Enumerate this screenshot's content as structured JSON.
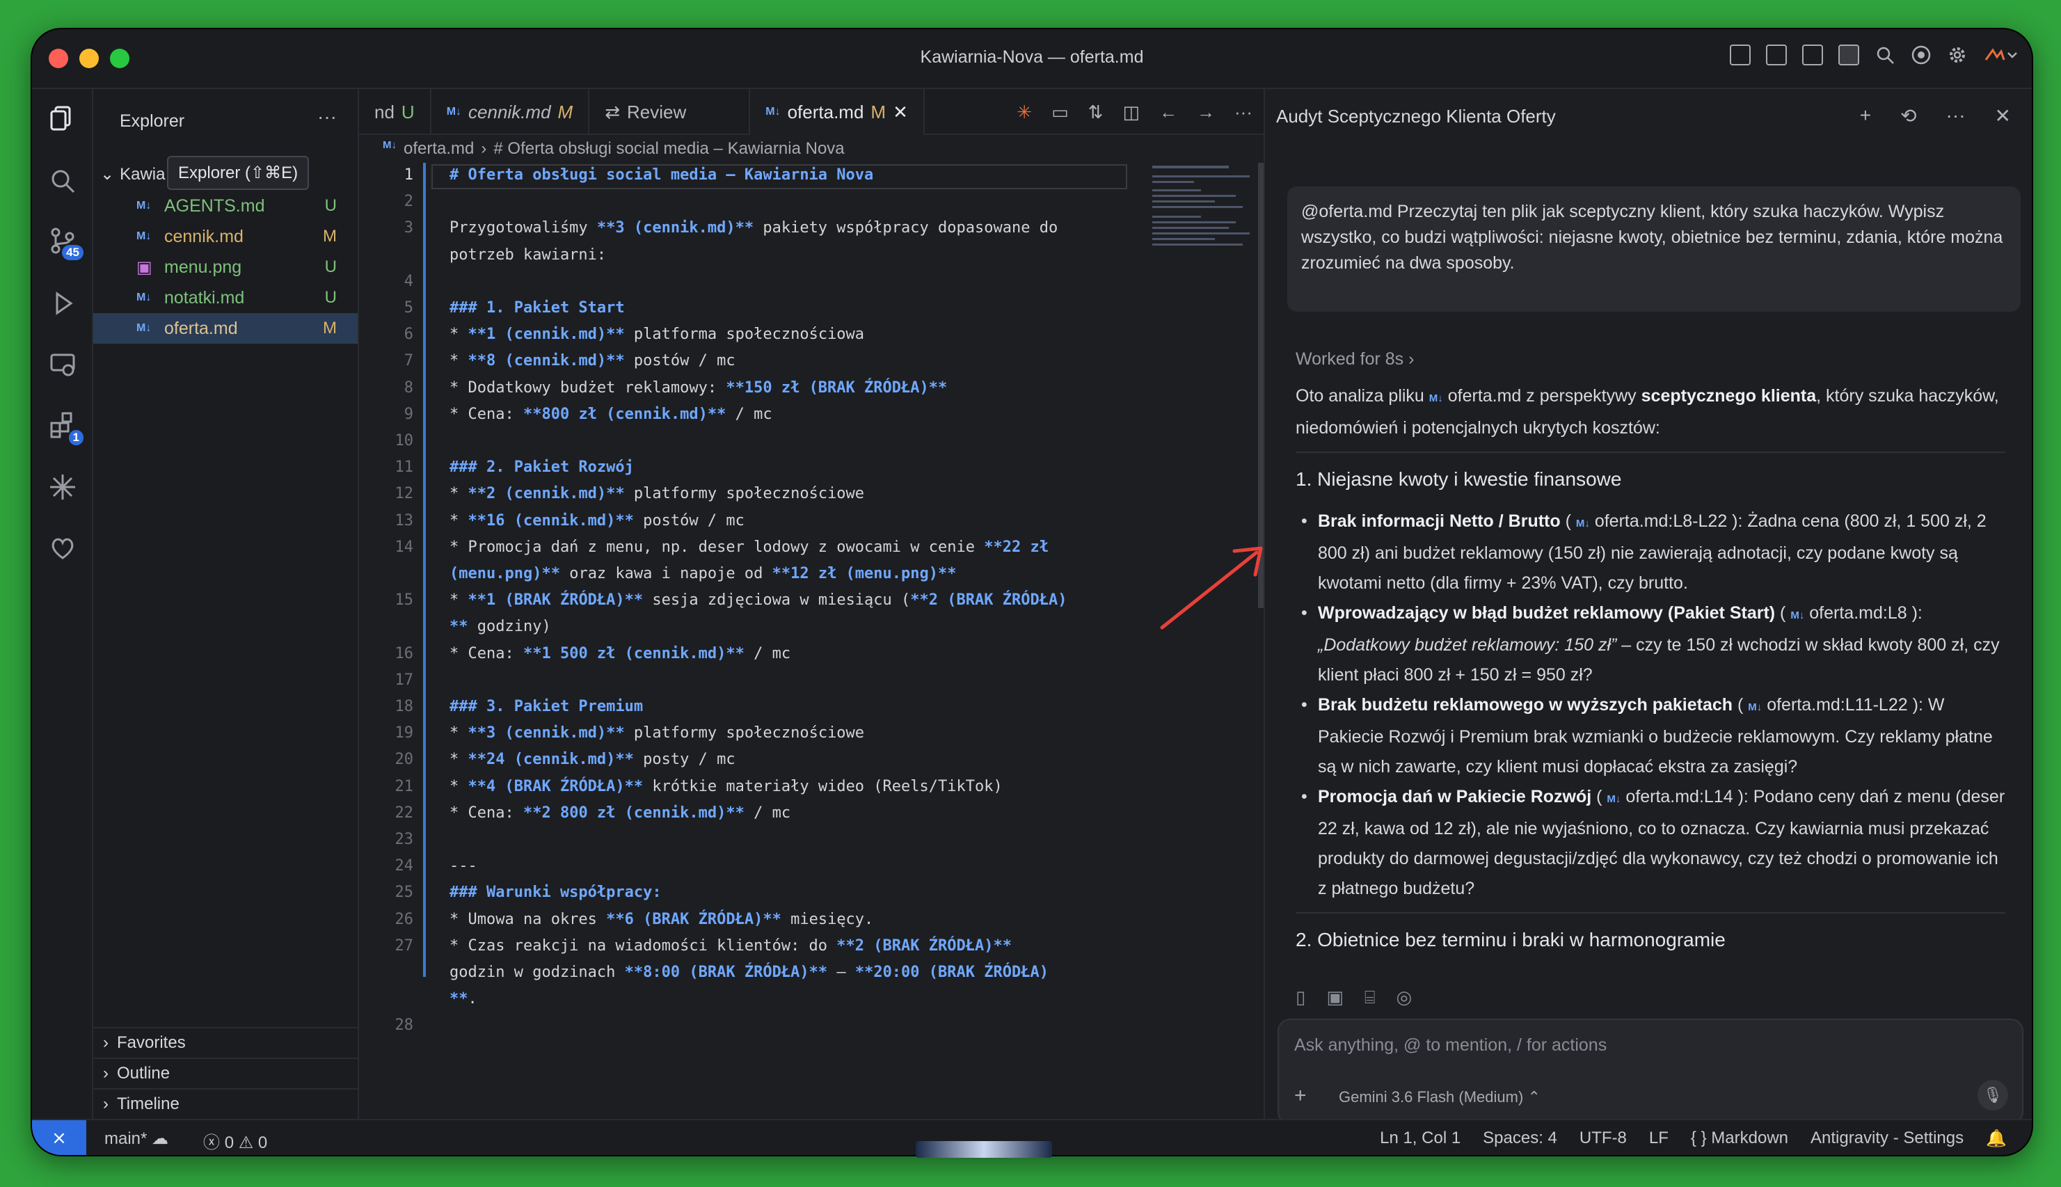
{
  "window": {
    "title": "Kawiarnia-Nova — oferta.md"
  },
  "colors": {
    "accent": "#3a7bd5",
    "untracked": "#7ec27a",
    "modified": "#d8b36a",
    "badge": "#2d6ce0",
    "annotation_arrow": "#e8403a"
  },
  "activity": {
    "source_control_badge": "45",
    "extensions_badge": "1"
  },
  "sidebar": {
    "title": "Explorer",
    "root_label": "Kawia",
    "tooltip": "Explorer (⇧⌘E)",
    "files": [
      {
        "icon": "M↓",
        "name": "AGENTS.md",
        "status": "U"
      },
      {
        "icon": "M↓",
        "name": "cennik.md",
        "status": "M"
      },
      {
        "icon": "▣",
        "name": "menu.png",
        "status": "U"
      },
      {
        "icon": "M↓",
        "name": "notatki.md",
        "status": "U"
      },
      {
        "icon": "M↓",
        "name": "oferta.md",
        "status": "M"
      }
    ],
    "sections": [
      "Favorites",
      "Outline",
      "Timeline"
    ]
  },
  "editor": {
    "tabs": [
      {
        "label": "nd",
        "status": "U"
      },
      {
        "label": "cennik.md",
        "status": "M"
      },
      {
        "label": "Review",
        "status": ""
      },
      {
        "label": "oferta.md",
        "status": "M"
      }
    ],
    "breadcrumb": [
      "oferta.md",
      "# Oferta obsługi social media – Kawiarnia Nova"
    ],
    "line_numbers": [
      "1",
      "2",
      "3",
      "",
      "4",
      "5",
      "6",
      "7",
      "8",
      "9",
      "10",
      "11",
      "12",
      "13",
      "14",
      "",
      "15",
      "",
      "16",
      "17",
      "18",
      "19",
      "20",
      "21",
      "22",
      "23",
      "24",
      "25",
      "26",
      "27",
      "",
      "",
      "28"
    ]
  },
  "agent": {
    "title": "Audyt Sceptycznego Klienta Oferty",
    "prompt": "@oferta.md Przeczytaj ten plik jak sceptyczny klient, który szuka haczyków. Wypisz wszystko, co budzi wątpliwości: niejasne kwoty, obietnice bez terminu, zdania, które można zrozumieć na dwa sposoby.",
    "worked": "Worked for 8s",
    "intro_a": "Oto analiza pliku",
    "intro_file": "oferta.md",
    "intro_b": "z perspektywy",
    "intro_bold": "sceptycznego klienta",
    "intro_c": ", który szuka haczyków, niedomówień i potencjalnych ukrytych kosztów:",
    "section1": "1. Niejasne kwoty i kwestie finansowe",
    "items": [
      {
        "title": "Brak informacji Netto / Brutto",
        "ref": "oferta.md:L8-L22",
        "text": ": Żadna cena (800 zł, 1 500 zł, 2 800 zł) ani budżet reklamowy (150 zł) nie zawierają adnotacji, czy podane kwoty są kwotami netto (dla firmy + 23% VAT), czy brutto."
      },
      {
        "title": "Wprowadzający w błąd budżet reklamowy (Pakiet Start)",
        "ref": "oferta.md:L8",
        "quote": "„Dodatkowy budżet reklamowy: 150 zł”",
        "text": " – czy te 150 zł wchodzi w skład kwoty 800 zł, czy klient płaci 800 zł + 150 zł = 950 zł?"
      },
      {
        "title": "Brak budżetu reklamowego w wyższych pakietach",
        "ref": "oferta.md:L11-L22",
        "text": ": W Pakiecie Rozwój i Premium brak wzmianki o budżecie reklamowym. Czy reklamy płatne są w nich zawarte, czy klient musi dopłacać ekstra za zasięgi?"
      },
      {
        "title": "Promocja dań w Pakiecie Rozwój",
        "ref": "oferta.md:L14",
        "text": ": Podano ceny dań z menu (deser 22 zł, kawa od 12 zł), ale nie wyjaśniono, co to oznacza. Czy kawiarnia musi przekazać produkty do darmowej degustacji/zdjęć dla wykonawcy, czy też chodzi o promowanie ich z płatnego budżetu?"
      }
    ],
    "section2": "2. Obietnice bez terminu i braki w harmonogramie",
    "input_placeholder": "Ask anything, @ to mention, / for actions",
    "model": "Gemini 3.6 Flash (Medium)"
  },
  "status": {
    "branch": "main*",
    "errors": "0",
    "warnings": "0",
    "position": "Ln 1, Col 1",
    "spaces": "Spaces: 4",
    "encoding": "UTF-8",
    "eol": "LF",
    "language": "Markdown",
    "settings": "Antigravity - Settings"
  }
}
